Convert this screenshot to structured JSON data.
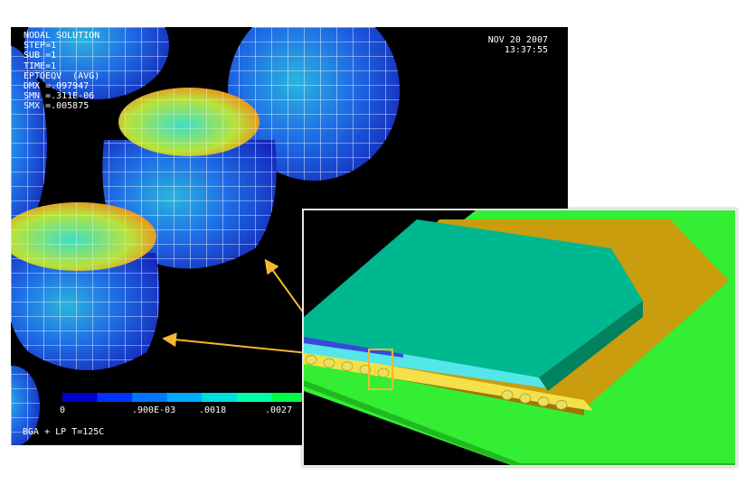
{
  "simulation": {
    "title": "NODAL SOLUTION",
    "step": "STEP=1",
    "sub": "SUB =1",
    "time": "TIME=1",
    "quantity": "EPTOEQV  (AVG)",
    "dmx": "DMX =.097947",
    "smn": "SMN =.311E-06",
    "smx": "SMX =.005875",
    "date": "NOV 20 2007",
    "clock": "13:37:55",
    "footer": "BGA + LP T=125C"
  },
  "legend": {
    "ticks": [
      "0",
      ".900E-03",
      ".0018",
      ".0027"
    ],
    "colors": [
      "#0000cc",
      "#0033ff",
      "#0077ff",
      "#00aaff",
      "#00dddd",
      "#00ffaa",
      "#00ff44"
    ]
  },
  "colors": {
    "solder_dark": "#1a2ecc",
    "solder_mid": "#1f6fe6",
    "solder_light": "#29b8d8",
    "solder_hot": "#e05a1c",
    "mesh": "#ffffff",
    "board": "#33ee33",
    "substrate": "#c99d0d",
    "die_top": "#00b890",
    "die_side": "#00825f",
    "underfill": "#55e6ea",
    "callout_arrow": "#f5b731"
  }
}
